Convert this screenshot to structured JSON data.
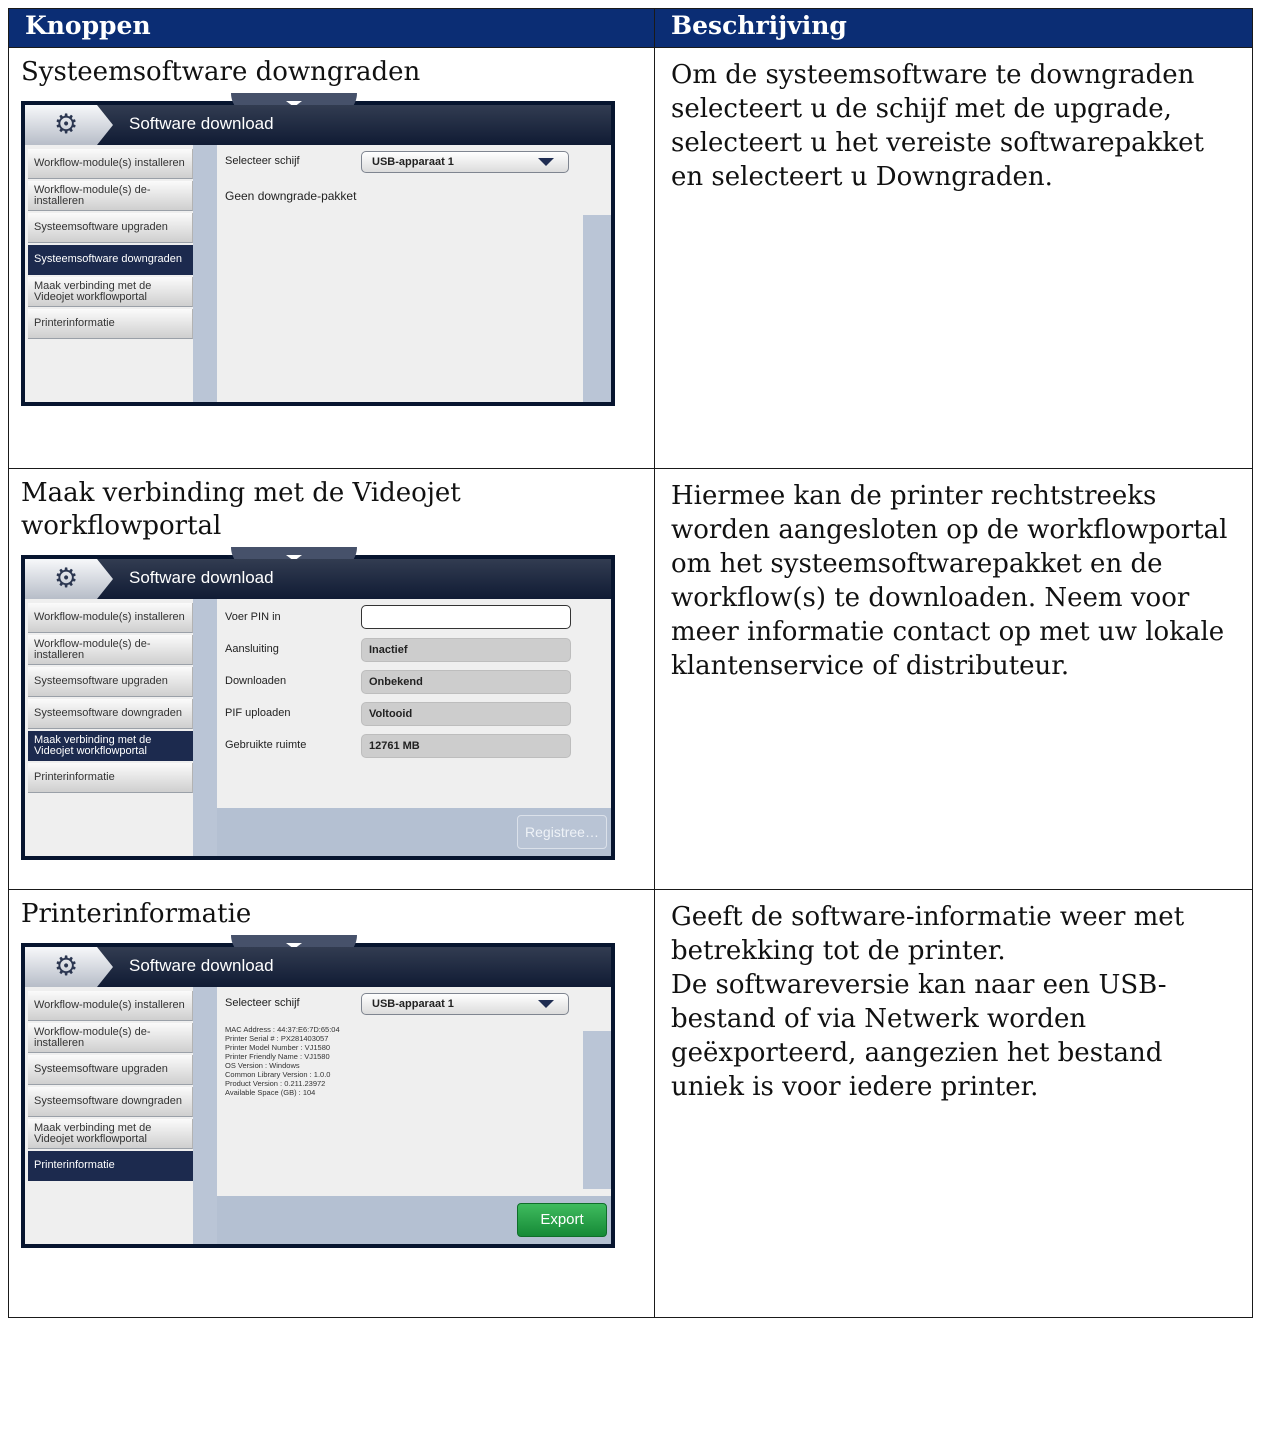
{
  "table": {
    "header_left": "Knoppen",
    "header_right": "Beschrijving"
  },
  "rows": [
    {
      "title": "Systeemsoftware downgraden",
      "description": "Om de systeemsoftware te downgraden selecteert u de schijf met de upgrade, selecteert u het vereiste softwarepakket en selecteert u Downgraden.",
      "screen": {
        "header_title": "Software download",
        "sidebar": [
          "Workflow-module(s) installeren",
          "Workflow-module(s) de-installeren",
          "Systeemsoftware upgraden",
          "Systeemsoftware downgraden",
          "Maak verbinding met de Videojet workflowportal",
          "Printerinformatie"
        ],
        "active_item": "Systeemsoftware downgraden",
        "drive_label": "Selecteer schijf",
        "drive_value": "USB-apparaat 1",
        "message": "Geen downgrade-pakket"
      }
    },
    {
      "title": "Maak verbinding met de Videojet workflowportal",
      "description": "Hiermee kan de printer rechtstreeks worden aangesloten op de workflowportal om het systeemsoftwarepakket en de workflow(s) te downloaden. Neem voor meer informatie contact op met uw lokale klantenservice of distributeur.",
      "screen": {
        "header_title": "Software download",
        "sidebar": [
          "Workflow-module(s) installeren",
          "Workflow-module(s) de-installeren",
          "Systeemsoftware upgraden",
          "Systeemsoftware downgraden",
          "Maak verbinding met de Videojet workflowportal",
          "Printerinformatie"
        ],
        "active_item": "Maak verbinding met de Videojet workflowportal",
        "fields": [
          {
            "label": "Voer PIN in",
            "value": ""
          },
          {
            "label": "Aansluiting",
            "value": "Inactief"
          },
          {
            "label": "Downloaden",
            "value": "Onbekend"
          },
          {
            "label": "PIF uploaden",
            "value": "Voltooid"
          },
          {
            "label": "Gebruikte ruimte",
            "value": "12761 MB"
          }
        ],
        "button": "Registree…"
      }
    },
    {
      "title": "Printerinformatie",
      "description": "Geeft de software-informatie weer met betrekking tot de printer.\nDe softwareversie kan naar een USB-bestand of via Netwerk worden geëxporteerd, aangezien het bestand uniek is voor iedere printer.",
      "screen": {
        "header_title": "Software download",
        "sidebar": [
          "Workflow-module(s) installeren",
          "Workflow-module(s) de-installeren",
          "Systeemsoftware upgraden",
          "Systeemsoftware downgraden",
          "Maak verbinding met de Videojet workflowportal",
          "Printerinformatie"
        ],
        "active_item": "Printerinformatie",
        "drive_label": "Selecteer schijf",
        "drive_value": "USB-apparaat 1",
        "info_lines": [
          "MAC Address : 44:37:E6:7D:65:04",
          "Printer Serial # : PX281403057",
          "Printer Model Number : VJ1580",
          "Printer Friendly Name : VJ1580",
          "OS Version : Windows",
          "Common Library Version : 1.0.0",
          "Product Version : 0.211.23972",
          "Available Space (GB) : 104"
        ],
        "button": "Export"
      }
    }
  ],
  "colors": {
    "header_bg": "#0b2d74",
    "active_item_bg": "#1c2a4e",
    "export_button": "#1f9a40"
  }
}
